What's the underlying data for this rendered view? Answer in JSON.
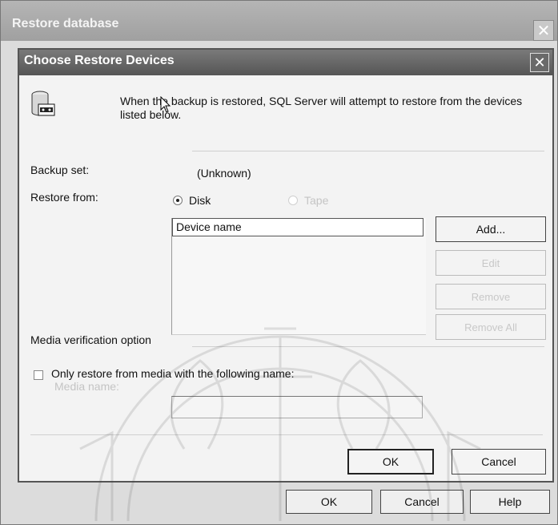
{
  "outer_window": {
    "title": "Restore database",
    "buttons": {
      "ok": "OK",
      "cancel": "Cancel",
      "help": "Help"
    }
  },
  "dialog": {
    "title": "Choose Restore Devices",
    "intro": "When the backup is restored, SQL Server will attempt to restore from the devices listed below.",
    "backup_set_label": "Backup set:",
    "backup_set_value": "(Unknown)",
    "restore_from_label": "Restore from:",
    "restore_options": [
      {
        "label": "Disk",
        "selected": true,
        "enabled": true
      },
      {
        "label": "Tape",
        "selected": false,
        "enabled": false
      }
    ],
    "device_list": {
      "column_header": "Device name",
      "items": []
    },
    "side_buttons": {
      "add": "Add...",
      "edit": "Edit",
      "remove": "Remove",
      "remove_all": "Remove All"
    },
    "media_verification_label": "Media verification option",
    "only_restore_label": "Only restore from media with the following name:",
    "media_name_label": "Media name:",
    "media_name_value": "",
    "buttons": {
      "ok": "OK",
      "cancel": "Cancel"
    }
  },
  "icons": [
    "database-tape-icon",
    "close-icon",
    "mouse-pointer-icon"
  ]
}
